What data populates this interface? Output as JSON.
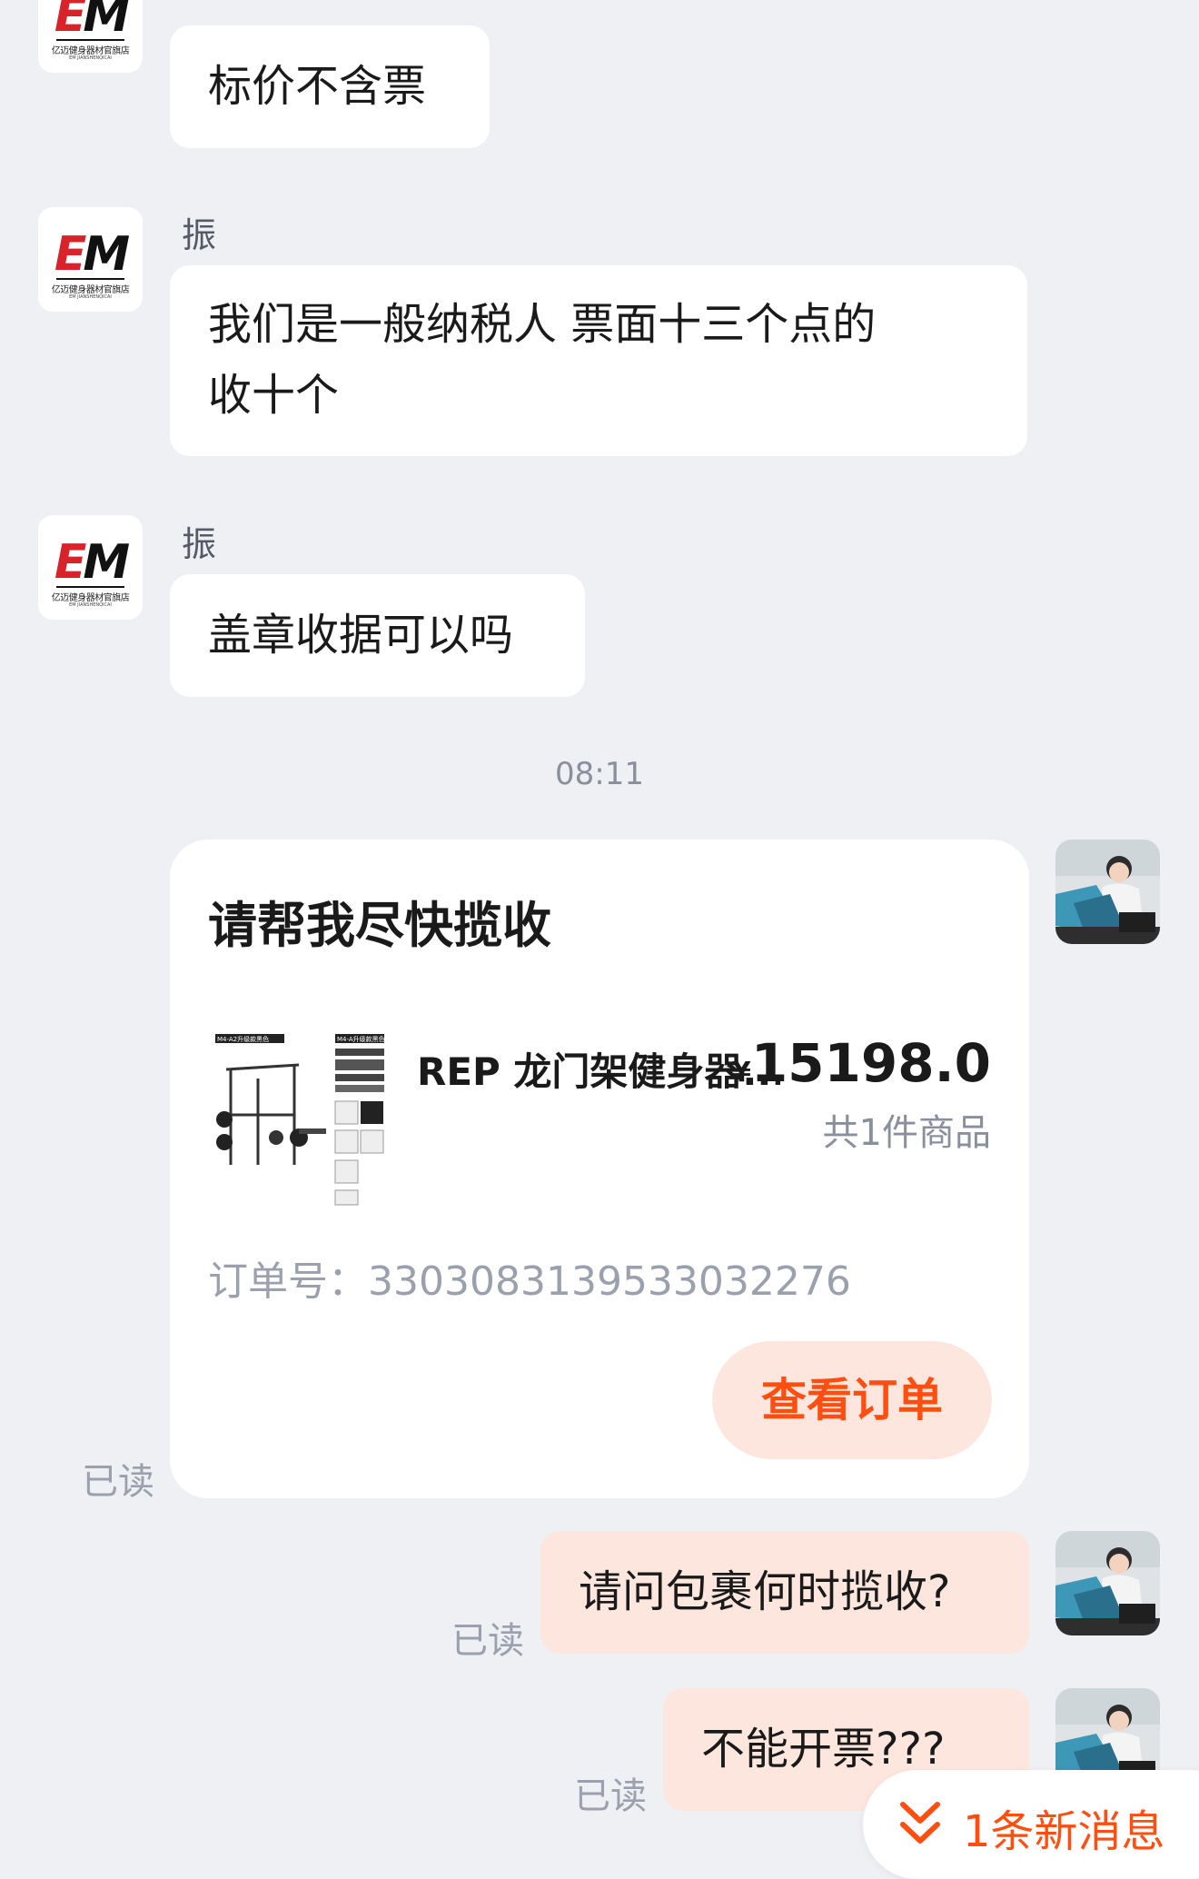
{
  "messages": [
    {
      "text": "标价不含票"
    },
    {
      "sender": "振",
      "text": "我们是一般纳税人 票面十三个点的\n收十个"
    },
    {
      "sender": "振",
      "text": "盖章收据可以吗"
    }
  ],
  "shop_avatar": {
    "logo_e": "E",
    "logo_m": "M",
    "store_name": "亿迈健身器材官旗店",
    "store_en": "EM JIANSHENQICAI"
  },
  "time_label": "08:11",
  "order_card": {
    "title": "请帮我尽快揽收",
    "product_name": "REP 龙门架健身器...",
    "currency": "¥",
    "price": "15198.0",
    "count": "共1件商品",
    "order_no": "订单号：3303083139533032276",
    "view_button": "查看订单",
    "thumb_tags": [
      "M4-A2升级款黑色",
      "M4-A升级款黑色"
    ]
  },
  "my_messages": [
    {
      "text": "请问包裹何时揽收?"
    },
    {
      "text": "不能开票???"
    }
  ],
  "read_label": "已读",
  "new_message_pill": "1条新消息",
  "colors": {
    "background": "#eff0f4",
    "bubble_other": "#ffffff",
    "bubble_mine": "#fde6de",
    "accent": "#ff4e0f"
  }
}
